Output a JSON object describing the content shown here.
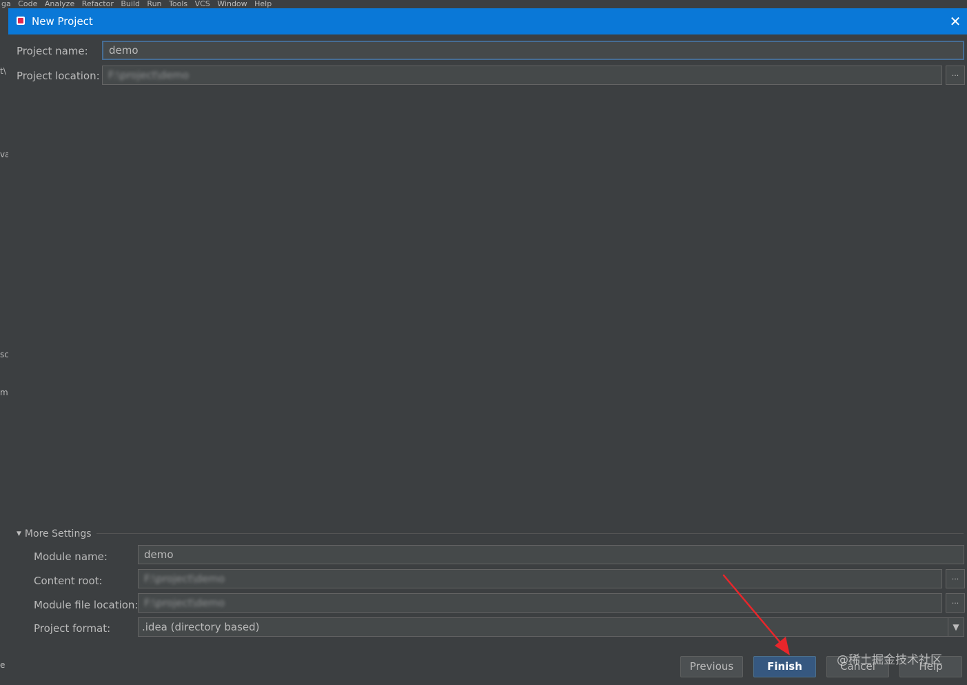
{
  "dialog": {
    "title": "New Project",
    "close_icon": "close-icon",
    "project_name_label": "Project name:",
    "project_name_value": "demo",
    "project_location_label": "Project location:",
    "project_location_value": "F:\\project\\demo",
    "browse_label": "...",
    "more_settings": {
      "header": "More Settings",
      "module_name_label": "Module name:",
      "module_name_value": "demo",
      "content_root_label": "Content root:",
      "content_root_value": "F:\\project\\demo",
      "module_file_location_label": "Module file location:",
      "module_file_location_value": "F:\\project\\demo",
      "project_format_label": "Project format:",
      "project_format_value": ".idea (directory based)"
    },
    "buttons": {
      "previous": "Previous",
      "finish": "Finish",
      "cancel": "Cancel",
      "help": "Help"
    }
  },
  "watermark": "@稀土掘金技术社区",
  "colors": {
    "titlebar": "#0a78d7",
    "dialog_bg": "#3c3f41",
    "field_bg": "#45494a",
    "primary_button": "#365880",
    "annotation_arrow": "#e8262b"
  }
}
